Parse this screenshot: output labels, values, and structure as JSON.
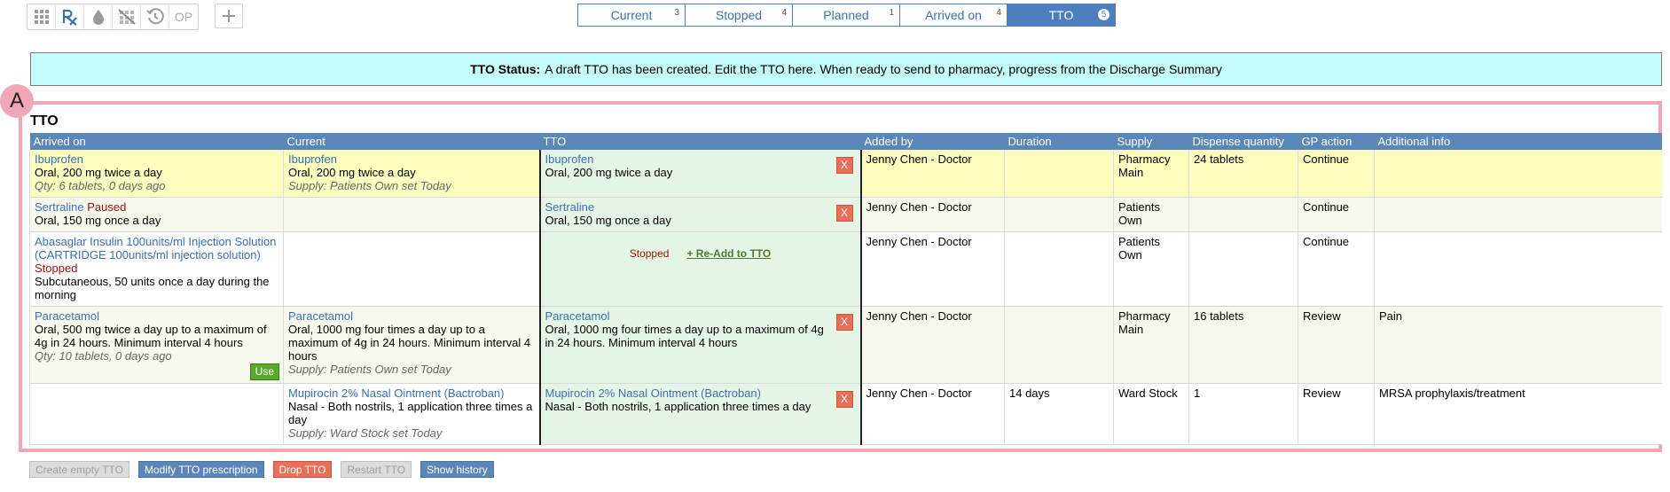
{
  "toolbar": {
    "icons": [
      "grid-icon",
      "rx-icon",
      "drop-icon",
      "strike-grid-icon",
      "history-icon"
    ],
    "op_label": "OP",
    "add_label": "+"
  },
  "tabs": [
    {
      "label": "Current",
      "count": "3"
    },
    {
      "label": "Stopped",
      "count": "4"
    },
    {
      "label": "Planned",
      "count": "1"
    },
    {
      "label": "Arrived on",
      "count": "4"
    },
    {
      "label": "TTO",
      "count": "5",
      "active": true
    }
  ],
  "banner": {
    "title": "TTO Status:",
    "text": "A draft TTO has been created. Edit the TTO here. When ready to send to pharmacy, progress from the Discharge Summary"
  },
  "badge": "A",
  "section_title": "TTO",
  "columns": [
    "Arrived on",
    "Current",
    "TTO",
    "Added by",
    "Duration",
    "Supply",
    "Dispense quantity",
    "GP action",
    "Additional info"
  ],
  "rows": [
    {
      "arrived": {
        "drug": "Ibuprofen",
        "status": "",
        "dose": "Oral, 200 mg twice a day",
        "note": "Qty: 6 tablets, 0 days ago"
      },
      "current": {
        "drug": "Ibuprofen",
        "dose": "Oral, 200 mg twice a day",
        "note": "Supply: Patients Own set Today"
      },
      "tto": {
        "drug": "Ibuprofen",
        "dose": "Oral, 200 mg twice a day",
        "x": "X"
      },
      "added_by": "Jenny Chen",
      "role": "Doctor",
      "duration": "",
      "supply": "Pharmacy Main",
      "dispense": "24 tablets",
      "gp_action": "Continue",
      "info": ""
    },
    {
      "arrived": {
        "drug": "Sertraline",
        "status": "Paused",
        "dose": "Oral, 150 mg once a day",
        "note": ""
      },
      "current": {
        "drug": "",
        "dose": "",
        "note": ""
      },
      "tto": {
        "drug": "Sertraline",
        "dose": "Oral, 150 mg once a day",
        "x": "X"
      },
      "added_by": "Jenny Chen",
      "role": "Doctor",
      "duration": "",
      "supply": "Patients Own",
      "dispense": "",
      "gp_action": "Continue",
      "info": ""
    },
    {
      "arrived": {
        "drug": "Abasaglar Insulin 100units/ml Injection Solution (CARTRIDGE 100units/ml injection solution)",
        "status": "Stopped",
        "dose": "Subcutaneous, 50 units once a day during the morning",
        "note": ""
      },
      "current": {
        "drug": "",
        "dose": "",
        "note": ""
      },
      "tto": {
        "stopped_label": "Stopped",
        "readd_label": "+ Re-Add to TTO"
      },
      "added_by": "Jenny Chen",
      "role": "Doctor",
      "duration": "",
      "supply": "Patients Own",
      "dispense": "",
      "gp_action": "Continue",
      "info": ""
    },
    {
      "arrived": {
        "drug": "Paracetamol",
        "status": "",
        "dose": "Oral, 500 mg twice a day up to a maximum of 4g in 24 hours. Minimum interval 4 hours",
        "note": "Qty: 10 tablets, 0 days ago",
        "use": "Use"
      },
      "current": {
        "drug": "Paracetamol",
        "dose": "Oral, 1000 mg four times a day up to a maximum of 4g in 24 hours. Minimum interval 4 hours",
        "note": "Supply: Patients Own set Today"
      },
      "tto": {
        "drug": "Paracetamol",
        "dose": "Oral, 1000 mg four times a day up to a maximum of 4g in 24 hours. Minimum interval 4 hours",
        "x": "X"
      },
      "added_by": "Jenny Chen",
      "role": "Doctor",
      "duration": "",
      "supply": "Pharmacy Main",
      "dispense": "16 tablets",
      "gp_action": "Review",
      "info": "Pain"
    },
    {
      "arrived": {
        "drug": "",
        "status": "",
        "dose": "",
        "note": ""
      },
      "current": {
        "drug": "Mupirocin 2% Nasal Ointment (Bactroban)",
        "dose": "Nasal - Both nostrils, 1 application three times a day",
        "note": "Supply: Ward Stock set Today"
      },
      "tto": {
        "drug": "Mupirocin 2% Nasal Ointment (Bactroban)",
        "dose": "Nasal - Both nostrils, 1 application three times a day",
        "x": "X"
      },
      "added_by": "Jenny Chen",
      "role": "Doctor",
      "duration": "14 days",
      "supply": "Ward Stock",
      "dispense": "1",
      "gp_action": "Review",
      "info": "MRSA prophylaxis/treatment"
    }
  ],
  "bottom_buttons": [
    {
      "label": "Create empty TTO",
      "style": "disabled"
    },
    {
      "label": "Modify TTO prescription",
      "style": "blue"
    },
    {
      "label": "Drop TTO",
      "style": "red"
    },
    {
      "label": "Restart TTO",
      "style": "disabled"
    },
    {
      "label": "Show history",
      "style": "blue"
    }
  ]
}
